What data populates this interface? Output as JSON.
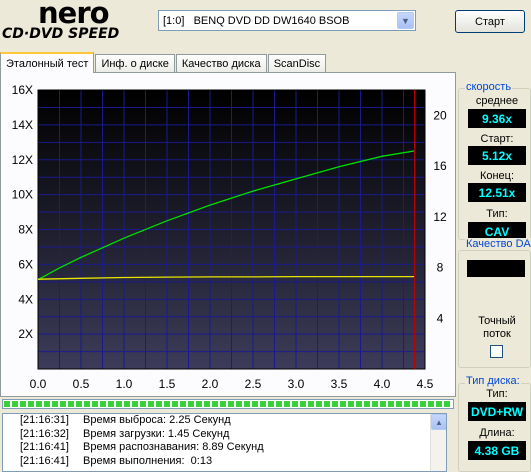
{
  "logo": {
    "brand": "nero",
    "product": "CD·DVD SPEED"
  },
  "drive": {
    "selected": "[1:0]   BENQ DVD DD DW1640 BSOB"
  },
  "start_button": "Старт",
  "tabs": [
    {
      "label": "Эталонный тест",
      "active": true
    },
    {
      "label": "Инф. о диске",
      "active": false
    },
    {
      "label": "Качество диска",
      "active": false
    },
    {
      "label": "ScanDisc",
      "active": false
    }
  ],
  "speed_panel": {
    "title": "скорость",
    "avg_label": "среднее",
    "avg_value": "9.36x",
    "start_label": "Старт:",
    "start_value": "5.12x",
    "end_label": "Конец:",
    "end_value": "12.51x",
    "type_label": "Тип:",
    "type_value": "CAV"
  },
  "quality_panel": {
    "title": "Качество DA",
    "accurate_label": "Точный",
    "accurate_label2": "поток",
    "checked": false
  },
  "disc_panel": {
    "title": "Тип диска:",
    "type_label": "Тип:",
    "type_value": "DVD+RW",
    "length_label": "Длина:",
    "length_value": "4.38 GB"
  },
  "progress": 1.0,
  "log": [
    {
      "time": "[21:16:31]",
      "text": "Время выброса: 2.25 Секунд"
    },
    {
      "time": "[21:16:32]",
      "text": "Время загрузки: 1.45 Секунд"
    },
    {
      "time": "[21:16:41]",
      "text": "Время распознавания: 8.89 Секунд"
    },
    {
      "time": "[21:16:41]",
      "text": "Время выполнения:  0:13"
    }
  ],
  "colors": {
    "plot_bg_top": "#000000",
    "plot_bg_bottom": "#3c3c5a",
    "grid": "#1a1a8c",
    "speed_curve": "#00e000",
    "secondary_curve": "#e6e600",
    "end_marker": "#c00000"
  },
  "chart_data": {
    "type": "line",
    "xlim": [
      0,
      4.5
    ],
    "ylim_left": [
      0,
      16
    ],
    "ylim_right": [
      0,
      22
    ],
    "x_ticks": [
      "0.0",
      "0.5",
      "1.0",
      "1.5",
      "2.0",
      "2.5",
      "3.0",
      "3.5",
      "4.0",
      "4.5"
    ],
    "y_left_ticks": [
      "2X",
      "4X",
      "6X",
      "8X",
      "10X",
      "12X",
      "14X",
      "16X"
    ],
    "y_right_ticks": [
      "4",
      "8",
      "12",
      "16",
      "20"
    ],
    "grid": true,
    "end_marker_x": 4.38,
    "series": [
      {
        "values_x": [
          0.0,
          0.25,
          0.5,
          1.0,
          1.5,
          2.0,
          2.5,
          3.0,
          3.5,
          4.0,
          4.38
        ],
        "values_y": [
          5.12,
          5.8,
          6.4,
          7.5,
          8.5,
          9.4,
          10.2,
          10.9,
          11.6,
          12.2,
          12.51
        ]
      },
      {
        "values_x": [
          0.0,
          0.5,
          1.0,
          1.5,
          2.0,
          2.5,
          3.0,
          3.5,
          4.0,
          4.38
        ],
        "values_y": [
          5.15,
          5.2,
          5.25,
          5.27,
          5.28,
          5.28,
          5.3,
          5.3,
          5.3,
          5.3
        ]
      }
    ]
  }
}
